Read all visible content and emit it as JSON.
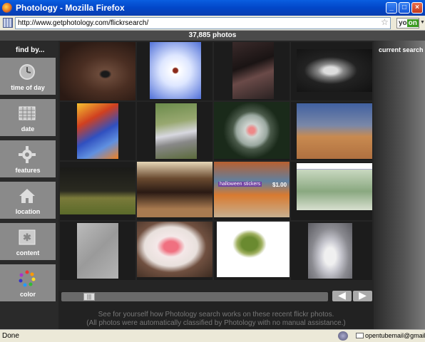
{
  "window": {
    "title": "Photology - Mozilla Firefox",
    "minimize": "_",
    "maximize": "□",
    "close": "×"
  },
  "address_bar": {
    "url": "http://www.getphotology.com/flickrsearch/",
    "addon_yo": "yo",
    "addon_on": "on"
  },
  "header": {
    "count": "37,885 photos"
  },
  "sidebar": {
    "title": "find by...",
    "filters": [
      {
        "label": "time of day",
        "icon": "clock-icon"
      },
      {
        "label": "date",
        "icon": "calendar-icon"
      },
      {
        "label": "features",
        "icon": "gear-icon"
      },
      {
        "label": "location",
        "icon": "house-icon"
      },
      {
        "label": "content",
        "icon": "content-icon"
      },
      {
        "label": "color",
        "icon": "color-wheel-icon"
      }
    ]
  },
  "right_panel": {
    "title": "current search"
  },
  "photos": [
    "eye-closeup",
    "spider-on-blue",
    "person-sitting",
    "woman-bw-portrait",
    "colorful-painting",
    "toy-train",
    "hamster-wheel",
    "basketball-game",
    "soccer-night",
    "choir-group",
    "halloween-stickers-store",
    "map-webpage",
    "wall-sketch",
    "jello-plate",
    "frog-toy",
    "snowman"
  ],
  "photo_captions": {
    "halloween_sign": "halloween stickers",
    "price": "$1.00"
  },
  "navigation": {
    "prev": "◀",
    "next": "▶",
    "scroll_grip": "|||"
  },
  "footer": {
    "line1": "See for yourself how Photology search works on these recent flickr photos.",
    "line2": "(All photos were automatically classified by Photology with no manual assistance.)"
  },
  "status_bar": {
    "status": "Done",
    "email": "opentubemail@gmail.com"
  }
}
